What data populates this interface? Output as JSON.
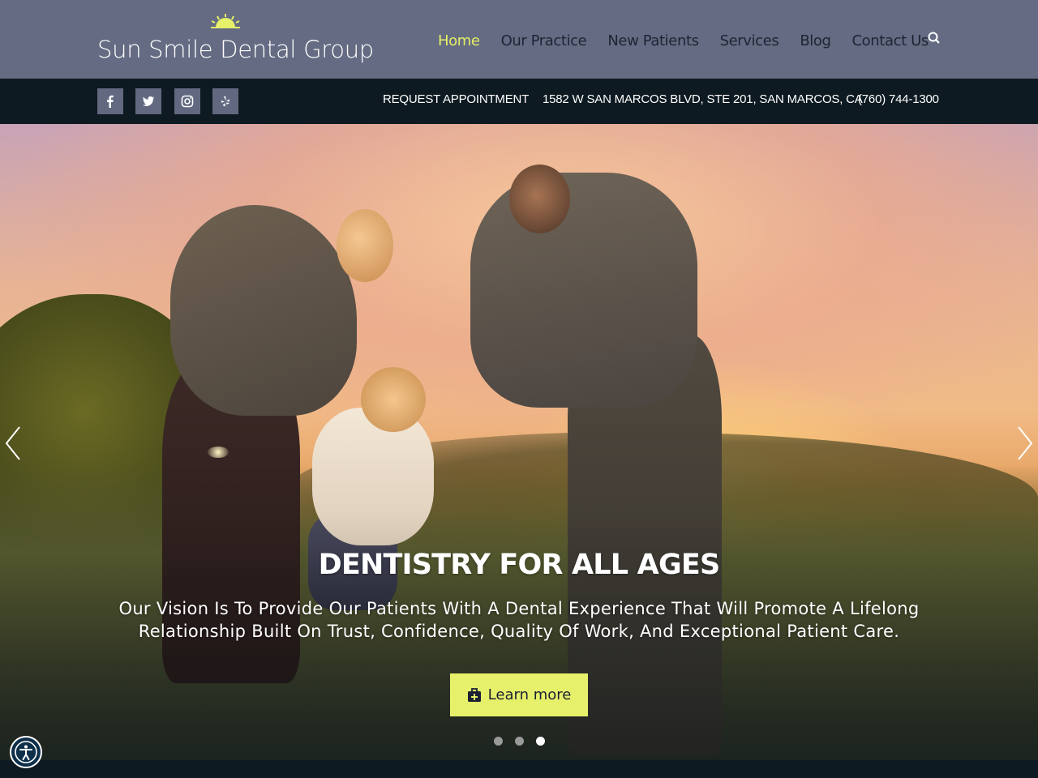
{
  "logo": {
    "text": "Sun Smile Dental Group"
  },
  "nav": {
    "items": [
      {
        "label": "Home",
        "active": true
      },
      {
        "label": "Our Practice"
      },
      {
        "label": "New Patients"
      },
      {
        "label": "Services"
      },
      {
        "label": "Blog"
      },
      {
        "label": "Contact Us"
      }
    ]
  },
  "topbar": {
    "social": [
      "facebook-icon",
      "twitter-icon",
      "instagram-icon",
      "yelp-icon"
    ],
    "request": "REQUEST APPOINTMENT",
    "address": "1582 W SAN MARCOS BLVD, STE 201, SAN MARCOS, CA",
    "phone": "(760) 744-1300"
  },
  "hero": {
    "title": "DENTISTRY FOR ALL AGES",
    "subtitle": "Our Vision Is To Provide Our Patients With A Dental Experience That Will Promote A Lifelong Relationship Built On Trust, Confidence, Quality Of Work, And Exceptional Patient Care.",
    "cta_label": "Learn more",
    "slide_count": 3,
    "active_slide": 3
  },
  "colors": {
    "header_bg": "#646b82",
    "topbar_bg": "#0e1a21",
    "accent": "#e7f06a",
    "nav_text": "#1f2433"
  }
}
